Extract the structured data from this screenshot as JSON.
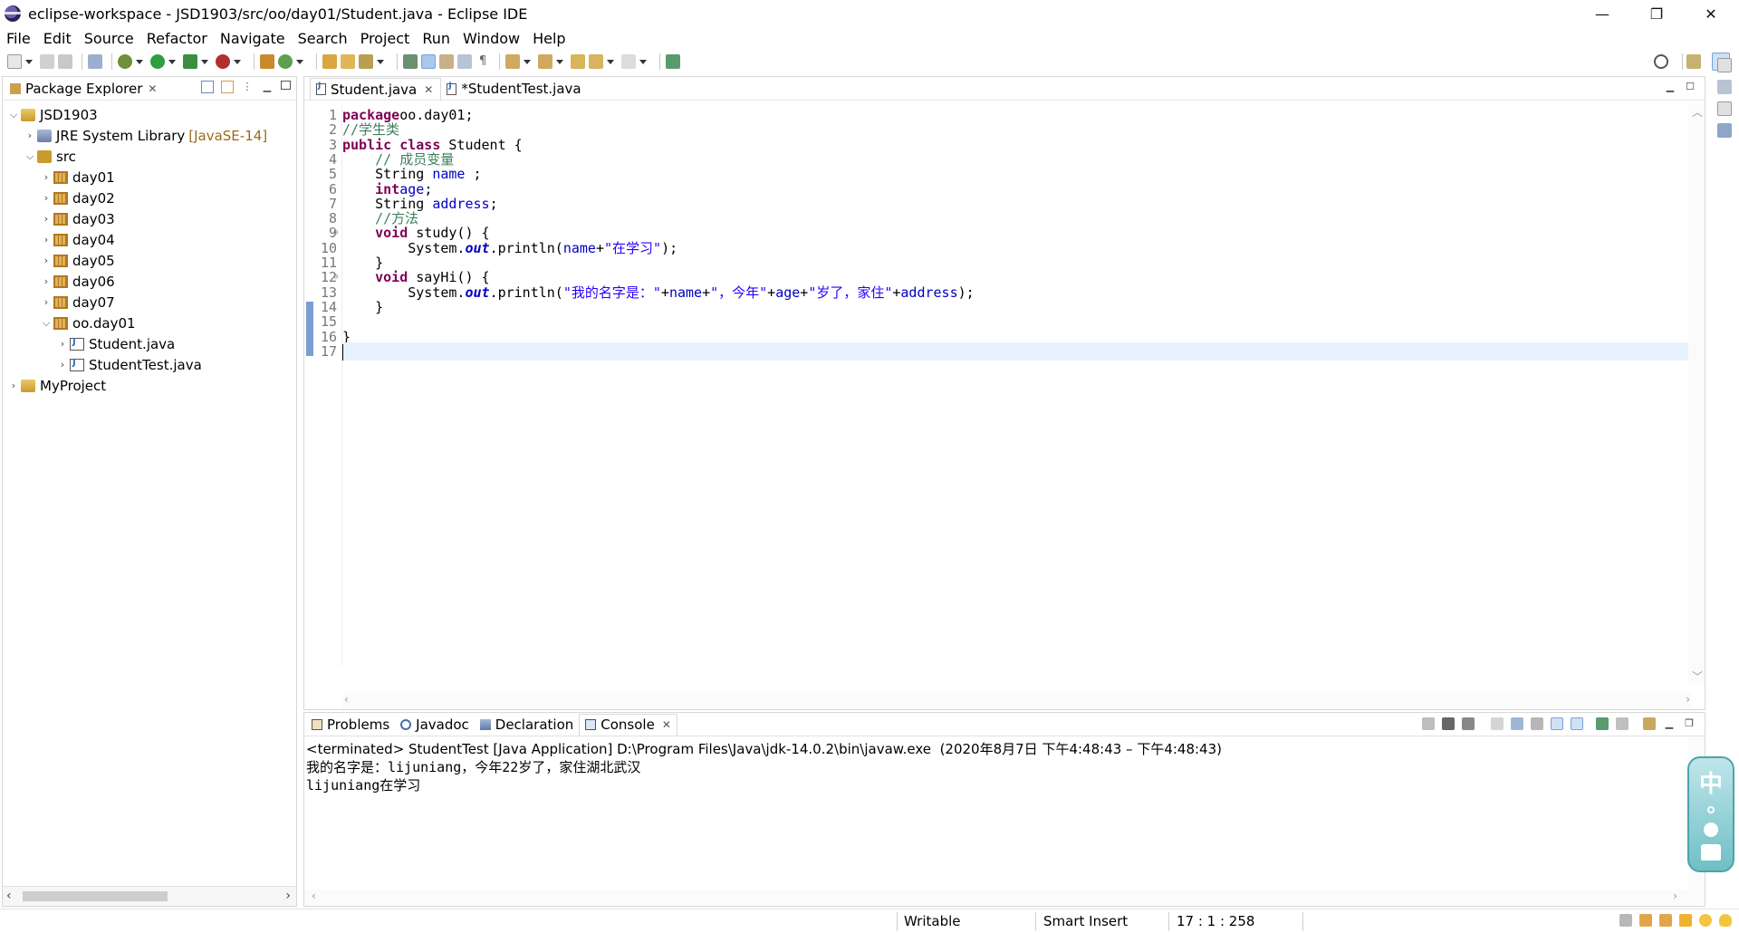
{
  "window": {
    "title": "eclipse-workspace - JSD1903/src/oo/day01/Student.java - Eclipse IDE",
    "minimize": "—",
    "restore": "❐",
    "close": "✕"
  },
  "menu": [
    "File",
    "Edit",
    "Source",
    "Refactor",
    "Navigate",
    "Search",
    "Project",
    "Run",
    "Window",
    "Help"
  ],
  "explorer": {
    "tab_label": "Package Explorer",
    "tree": [
      {
        "label": "JSD1903",
        "twisty": "⌵",
        "indent": 0,
        "icon": "project"
      },
      {
        "label": "JRE System Library",
        "decoration": "[JavaSE-14]",
        "twisty": "›",
        "indent": 1,
        "icon": "lib"
      },
      {
        "label": "src",
        "twisty": "⌵",
        "indent": 1,
        "icon": "src"
      },
      {
        "label": "day01",
        "twisty": "›",
        "indent": 2,
        "icon": "pkg"
      },
      {
        "label": "day02",
        "twisty": "›",
        "indent": 2,
        "icon": "pkg"
      },
      {
        "label": "day03",
        "twisty": "›",
        "indent": 2,
        "icon": "pkg"
      },
      {
        "label": "day04",
        "twisty": "›",
        "indent": 2,
        "icon": "pkg"
      },
      {
        "label": "day05",
        "twisty": "›",
        "indent": 2,
        "icon": "pkg"
      },
      {
        "label": "day06",
        "twisty": "›",
        "indent": 2,
        "icon": "pkg"
      },
      {
        "label": "day07",
        "twisty": "›",
        "indent": 2,
        "icon": "pkg"
      },
      {
        "label": "oo.day01",
        "twisty": "⌵",
        "indent": 2,
        "icon": "pkg"
      },
      {
        "label": "Student.java",
        "twisty": "›",
        "indent": 3,
        "icon": "java"
      },
      {
        "label": "StudentTest.java",
        "twisty": "›",
        "indent": 3,
        "icon": "java"
      },
      {
        "label": "MyProject",
        "twisty": "›",
        "indent": 0,
        "icon": "project"
      }
    ]
  },
  "editor": {
    "tabs": [
      {
        "label": "Student.java",
        "active": true
      },
      {
        "label": "*StudentTest.java",
        "active": false
      }
    ],
    "lines": [
      [
        [
          "kw",
          "package"
        ],
        [
          "",
          "oo.day01;"
        ]
      ],
      [
        [
          "cm",
          "//学生类"
        ]
      ],
      [
        [
          "kw",
          "public class"
        ],
        [
          "",
          " Student {"
        ]
      ],
      [
        [
          "",
          "    "
        ],
        [
          "cm",
          "// 成员变量"
        ]
      ],
      [
        [
          "",
          "    String "
        ],
        [
          "fld",
          "name"
        ],
        [
          "",
          " ;"
        ]
      ],
      [
        [
          "",
          "    "
        ],
        [
          "kw",
          "int"
        ],
        [
          "",
          ""
        ],
        [
          "fld",
          "age"
        ],
        [
          "",
          ";"
        ]
      ],
      [
        [
          "",
          "    String "
        ],
        [
          "fld",
          "address"
        ],
        [
          "",
          ";"
        ]
      ],
      [
        [
          "",
          "    "
        ],
        [
          "cm",
          "//方法"
        ]
      ],
      [
        [
          "",
          "    "
        ],
        [
          "kw",
          "void"
        ],
        [
          "",
          " study() {"
        ]
      ],
      [
        [
          "",
          "        System."
        ],
        [
          "st",
          "out"
        ],
        [
          "",
          ".println("
        ],
        [
          "fld",
          "name"
        ],
        [
          "",
          "+"
        ],
        [
          "str",
          "\"在学习\""
        ],
        [
          "",
          ");"
        ]
      ],
      [
        [
          "",
          "    }"
        ]
      ],
      [
        [
          "",
          "    "
        ],
        [
          "kw",
          "void"
        ],
        [
          "",
          " sayHi() {"
        ]
      ],
      [
        [
          "",
          "        System."
        ],
        [
          "st",
          "out"
        ],
        [
          "",
          ".println("
        ],
        [
          "str",
          "\"我的名字是：\""
        ],
        [
          "",
          "+"
        ],
        [
          "fld",
          "name"
        ],
        [
          "",
          "+"
        ],
        [
          "str",
          "\"，今年\""
        ],
        [
          "",
          "+"
        ],
        [
          "fld",
          "age"
        ],
        [
          "",
          "+"
        ],
        [
          "str",
          "\"岁了，家住\""
        ],
        [
          "",
          "+"
        ],
        [
          "fld",
          "address"
        ],
        [
          "",
          ");"
        ]
      ],
      [
        [
          "",
          "    }"
        ]
      ],
      [
        [
          "",
          ""
        ]
      ],
      [
        [
          "",
          "}"
        ]
      ],
      [
        [
          "",
          ""
        ]
      ]
    ],
    "line_markers": {
      "9": "⊖",
      "12": "⊖"
    },
    "current_line": 17
  },
  "console": {
    "tabs": [
      {
        "label": "Problems",
        "icon": "problems"
      },
      {
        "label": "Javadoc",
        "icon": "javadoc"
      },
      {
        "label": "Declaration",
        "icon": "decl"
      },
      {
        "label": "Console",
        "icon": "console",
        "active": true
      }
    ],
    "terminated": "<terminated> StudentTest [Java Application] D:\\Program Files\\Java\\jdk-14.0.2\\bin\\javaw.exe  (2020年8月7日 下午4:48:43 – 下午4:48:43)",
    "output": [
      "我的名字是：lijuniang，今年22岁了，家住湖北武汉",
      "lijuniang在学习"
    ]
  },
  "ime": {
    "label": "中"
  },
  "status": {
    "writable": "Writable",
    "insert_mode": "Smart Insert",
    "position": "17 : 1 : 258"
  }
}
